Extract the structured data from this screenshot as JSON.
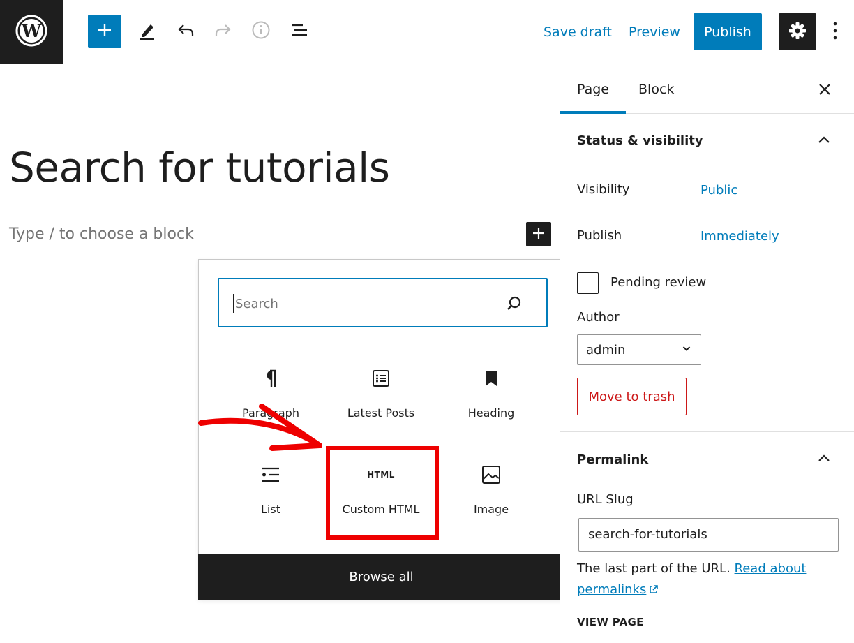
{
  "colors": {
    "accent": "#007cba",
    "dark": "#1e1e1e",
    "danger": "#cc1818",
    "annotation": "#ee0000"
  },
  "toolbar": {
    "logo_icon": "wordpress-logo-icon",
    "add_icon": "plus-icon",
    "tools_icon": "pencil-icon",
    "undo_icon": "undo-icon",
    "redo_icon": "redo-icon",
    "details_icon": "info-icon",
    "outline_icon": "list-view-icon",
    "save_draft_label": "Save draft",
    "preview_label": "Preview",
    "publish_label": "Publish",
    "settings_icon": "gear-icon",
    "more_icon": "vertical-ellipsis-icon"
  },
  "editor": {
    "title": "Search for tutorials",
    "placeholder": "Type / to choose a block"
  },
  "inserter": {
    "search_placeholder": "Search",
    "blocks": [
      {
        "label": "Paragraph",
        "icon": "pilcrow-icon"
      },
      {
        "label": "Latest Posts",
        "icon": "post-list-icon"
      },
      {
        "label": "Heading",
        "icon": "bookmark-icon"
      },
      {
        "label": "List",
        "icon": "list-icon"
      },
      {
        "label": "Custom HTML",
        "icon": "html-icon",
        "icon_text": "HTML"
      },
      {
        "label": "Image",
        "icon": "image-icon"
      }
    ],
    "browse_all_label": "Browse all"
  },
  "sidebar": {
    "tabs": [
      {
        "label": "Page",
        "active": true
      },
      {
        "label": "Block",
        "active": false
      }
    ],
    "status": {
      "heading": "Status & visibility",
      "visibility_label": "Visibility",
      "visibility_value": "Public",
      "publish_label": "Publish",
      "publish_value": "Immediately",
      "pending_review_label": "Pending review",
      "pending_review_checked": false,
      "author_label": "Author",
      "author_value": "admin",
      "trash_label": "Move to trash"
    },
    "permalink": {
      "heading": "Permalink",
      "slug_label": "URL Slug",
      "slug_value": "search-for-tutorials",
      "help_text": "The last part of the URL.",
      "help_link": "Read about permalinks",
      "view_page_label": "VIEW PAGE"
    }
  }
}
